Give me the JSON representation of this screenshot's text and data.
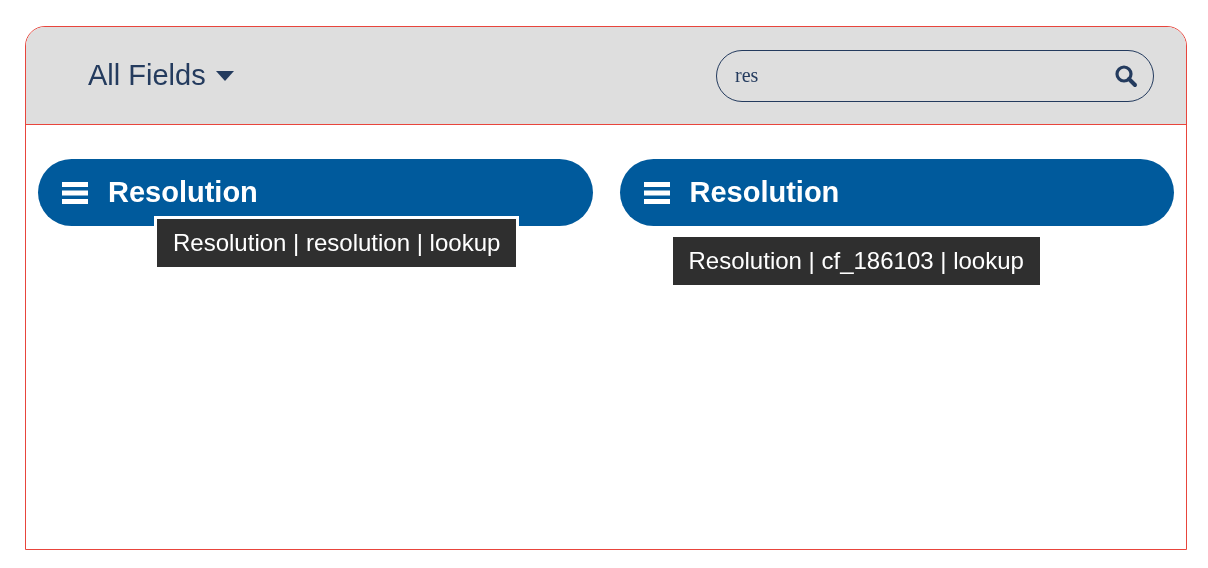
{
  "header": {
    "filter": {
      "label": "All Fields"
    },
    "search": {
      "value": "res"
    }
  },
  "fields": [
    {
      "label": "Resolution",
      "tooltip": "Resolution | resolution | lookup"
    },
    {
      "label": "Resolution",
      "tooltip": "Resolution | cf_186103 | lookup"
    }
  ]
}
